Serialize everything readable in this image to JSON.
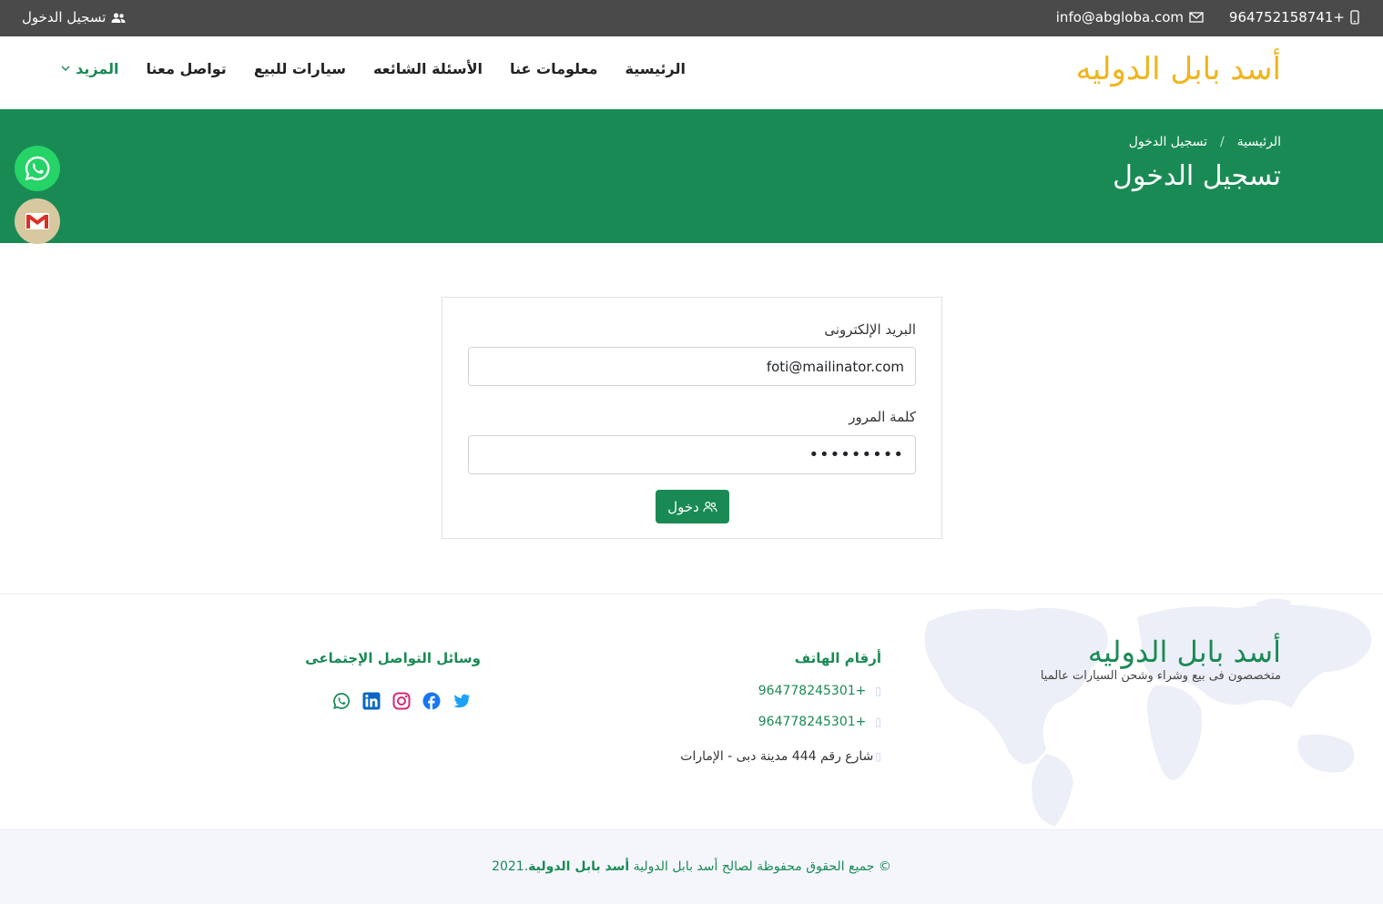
{
  "topbar": {
    "phone": "964752158741+",
    "email": "info@abgloba.com",
    "login": "تسجيل الدخول",
    "phone_icon": "mobile-phone-icon",
    "email_icon": "envelope-icon",
    "login_icon": "users-icon"
  },
  "header": {
    "brand": "أسد بابل الدوليه",
    "nav": [
      "الرئيسية",
      "معلومات عنا",
      "الأسئلة الشائعه",
      "سيارات للبيع",
      "تواصل معنا"
    ],
    "more": "المزيد"
  },
  "hero": {
    "breadcrumb_home": "الرئيسية",
    "breadcrumb_sep": "/",
    "breadcrumb_current": "تسجيل الدخول",
    "title": "تسجيل الدخول"
  },
  "login_form": {
    "email_label": "البريد الإلكترونى",
    "email_value": "foti@mailinator.com",
    "password_label": "كلمة المرور",
    "password_value": "•••••••••",
    "submit_label": "دخول"
  },
  "footer": {
    "brand": "أسد بابل الدوليه",
    "tagline": "متخصصون فى بيع وشراء وشحن السيارات عالميا",
    "phones_title": "أرقام الهاتف",
    "phones": [
      "964778245301+",
      "964778245301+"
    ],
    "address": "شارع رقم 444 مدينة دبى - الإمارات",
    "social_title": "وسائل التواصل الإجتماعى",
    "socials": [
      "twitter-icon",
      "facebook-icon",
      "instagram-icon",
      "linkedin-icon",
      "whatsapp-icon"
    ]
  },
  "copyright": {
    "prefix": "© جميع الحقوق محفوظة لصالح أسد بابل الدولية ",
    "brand": "أسد بابل الدولية",
    "year": ".2021"
  },
  "colors": {
    "primary": "#1a8a55",
    "brand_yellow": "#f0b51d",
    "topbar": "#4a4a4a",
    "whatsapp": "#25d366"
  }
}
